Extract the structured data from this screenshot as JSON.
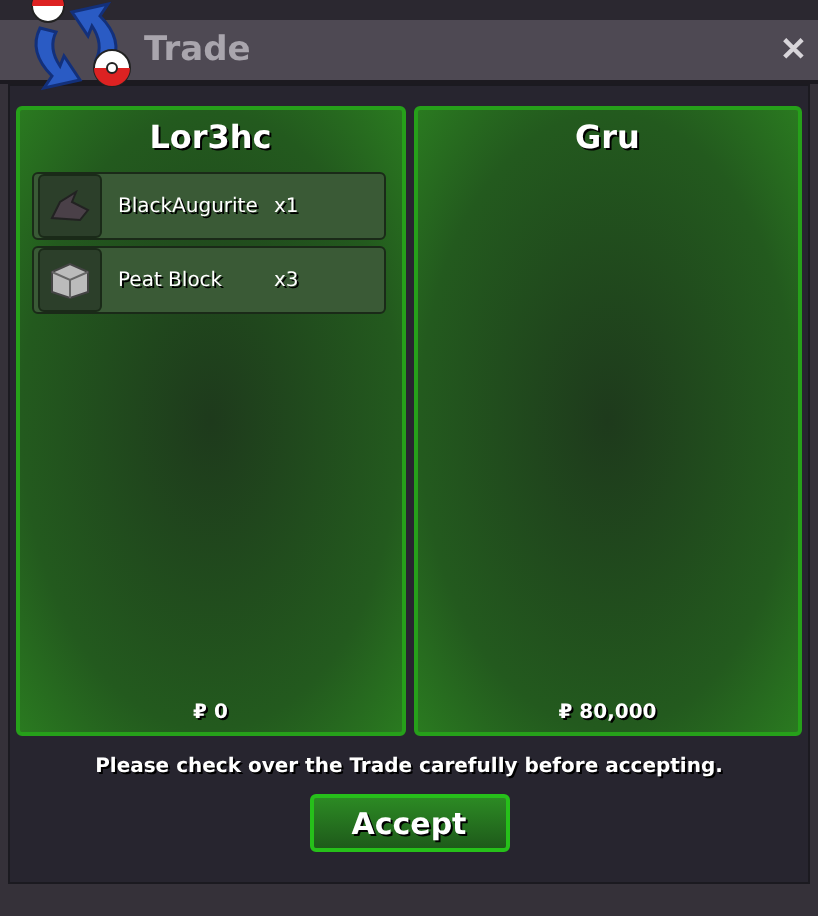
{
  "window": {
    "title": "Trade",
    "close": "✕"
  },
  "panels": [
    {
      "name": "Lor3hc",
      "items": [
        {
          "kind": "ore",
          "name": "BlackAugurite",
          "qty": "x1"
        },
        {
          "kind": "block",
          "name": "Peat Block",
          "qty": "x3"
        }
      ],
      "money": "₽ 0"
    },
    {
      "name": "Gru",
      "money": "₽ 80,000"
    }
  ],
  "notice": "Please check over the Trade carefully before accepting.",
  "button": "Accept"
}
